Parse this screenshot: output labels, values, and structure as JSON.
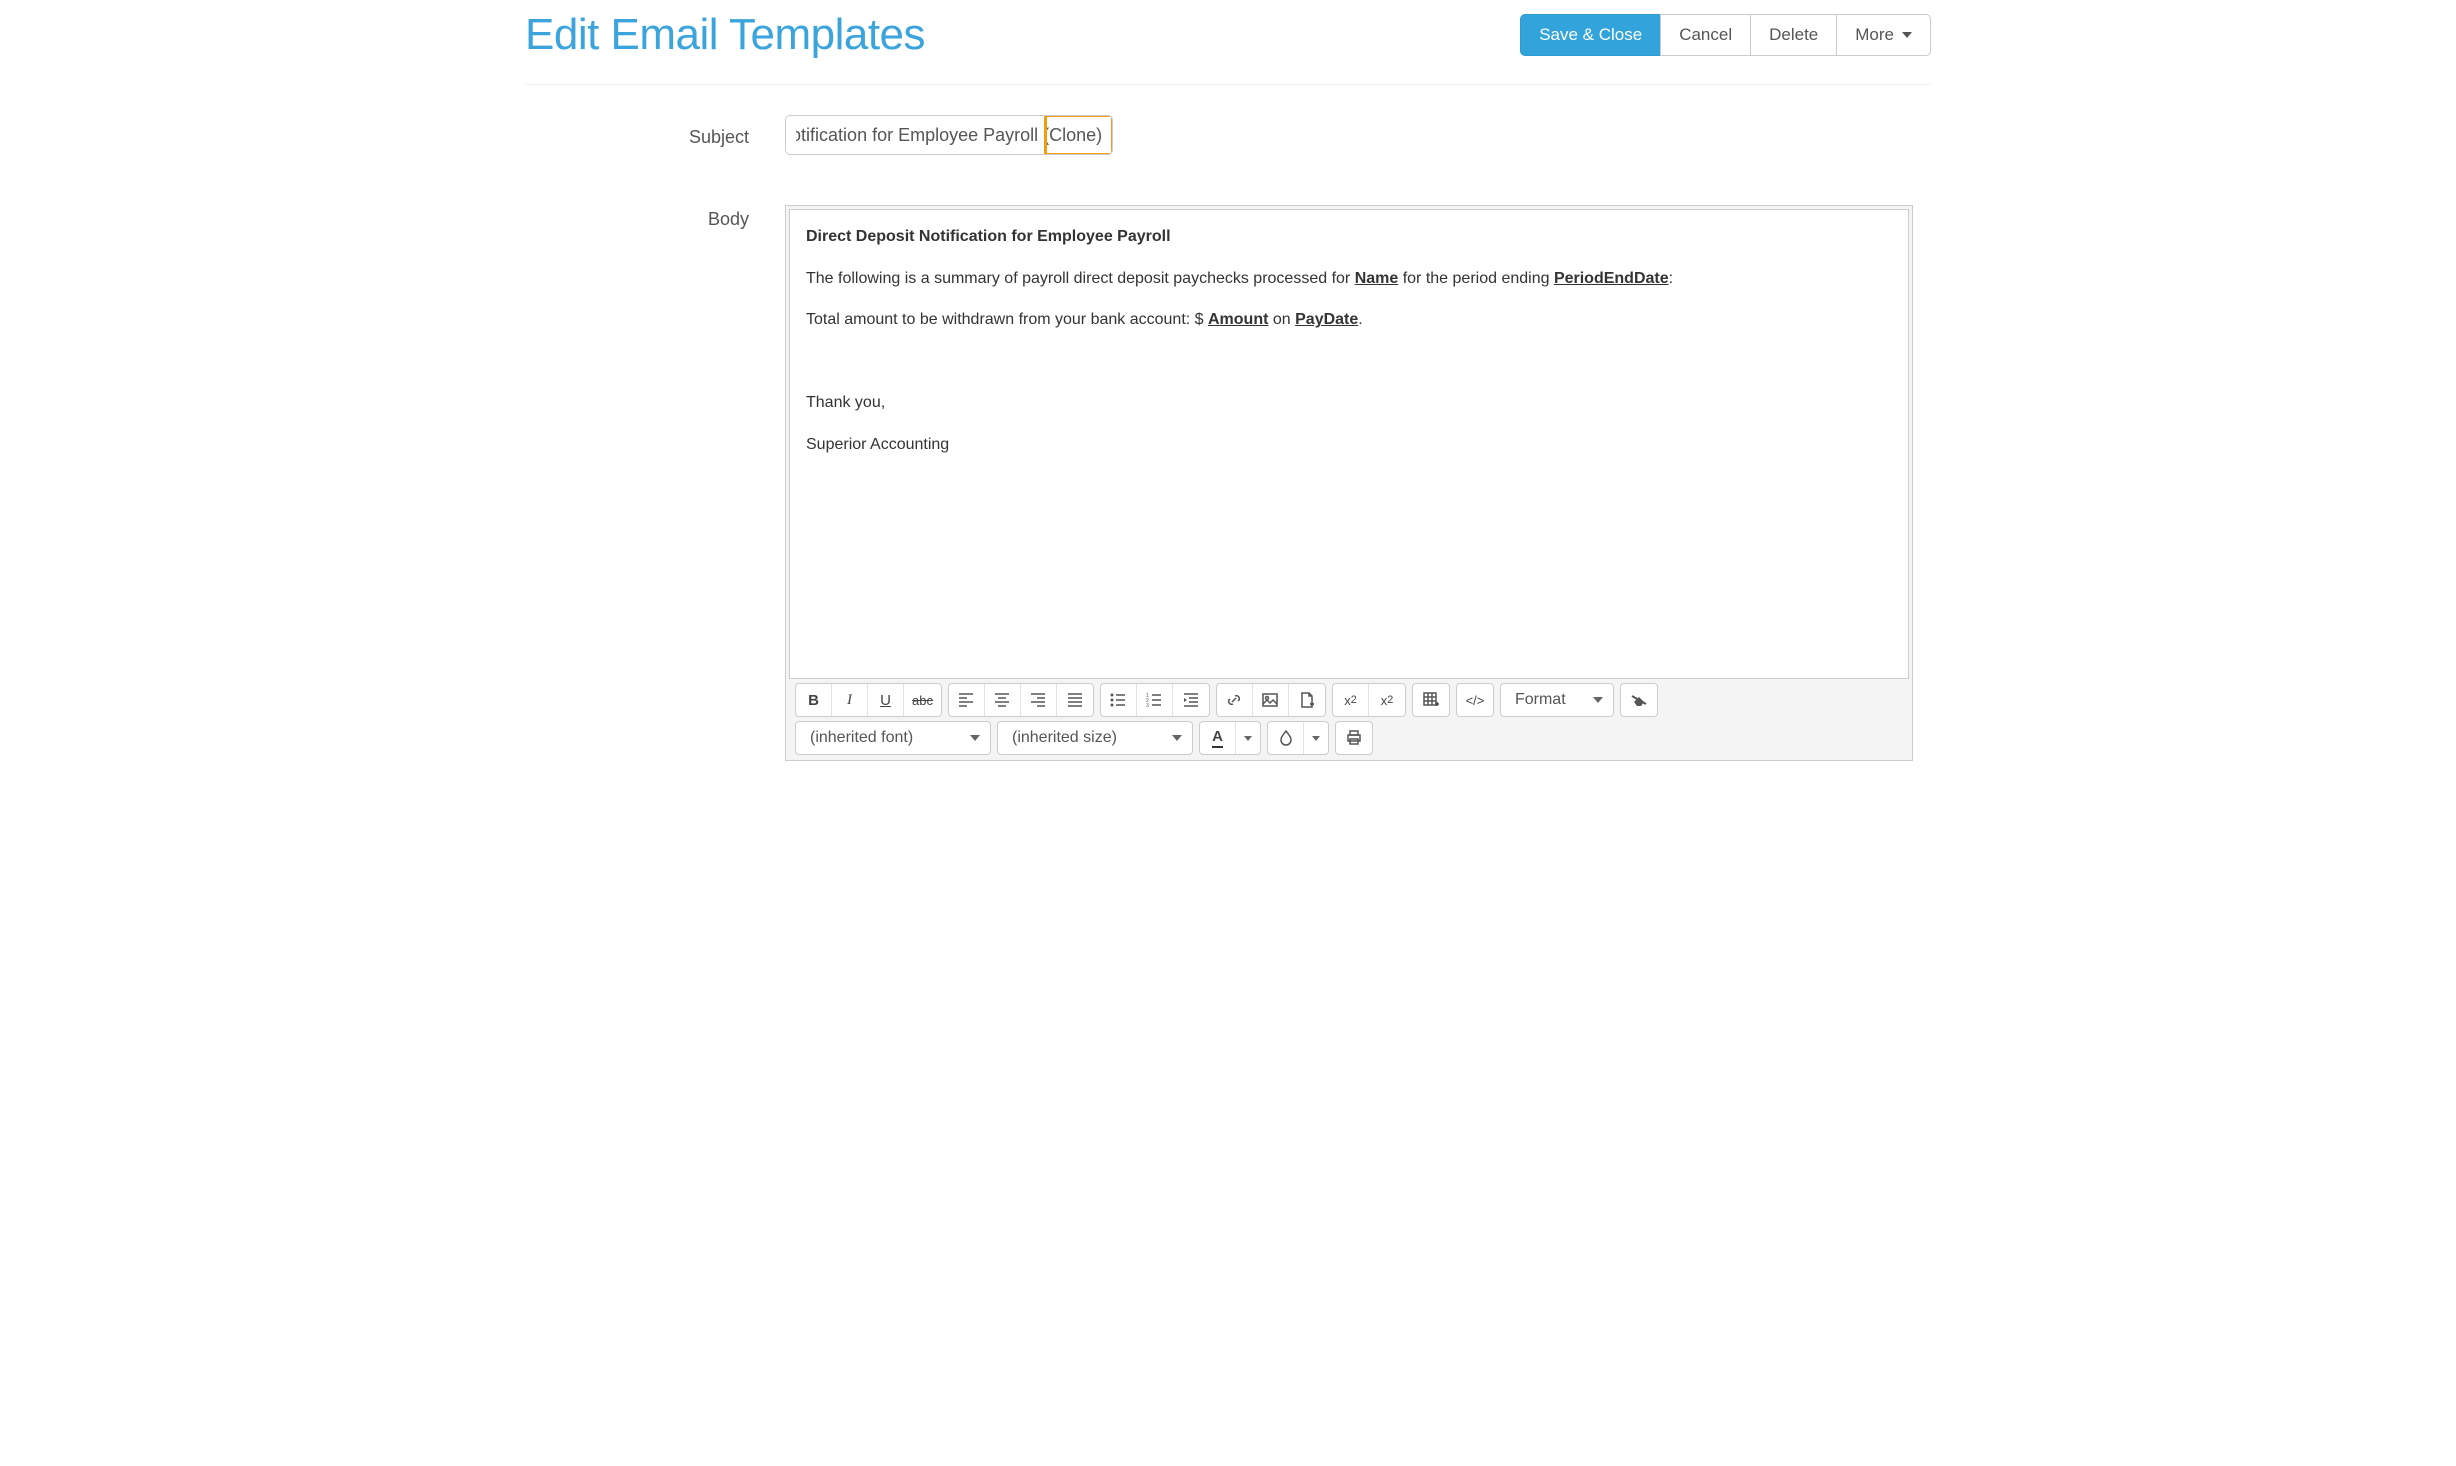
{
  "page": {
    "title": "Edit Email Templates"
  },
  "buttons": {
    "save": "Save & Close",
    "cancel": "Cancel",
    "delete": "Delete",
    "more": "More"
  },
  "labels": {
    "subject": "Subject",
    "body": "Body"
  },
  "subject": {
    "visible_text": "sit Notification for Employee Payroll (Clone)",
    "full_value": "Direct Deposit Notification for Employee Payroll (Clone)"
  },
  "body_content": {
    "heading": "Direct Deposit Notification for Employee Payroll",
    "line1_a": "The following is a summary of payroll direct deposit paychecks processed for ",
    "var_name": "Name",
    "line1_b": " for the period ending ",
    "var_period": "PeriodEndDate",
    "line1_punct": ":",
    "line2_a": "Total amount to be withdrawn from your bank account:  $ ",
    "var_amount": "Amount",
    "line2_b": " on ",
    "var_paydate": "PayDate",
    "line2_punct": ".",
    "line3": "Thank you,",
    "line4": "Superior Accounting"
  },
  "toolbar": {
    "bold": "B",
    "italic": "I",
    "underline": "U",
    "strike": "abc",
    "format": "Format",
    "font": "(inherited font)",
    "size": "(inherited size)",
    "font_color": "A",
    "code": "</>",
    "sub": "x₂",
    "sup": "x²"
  }
}
